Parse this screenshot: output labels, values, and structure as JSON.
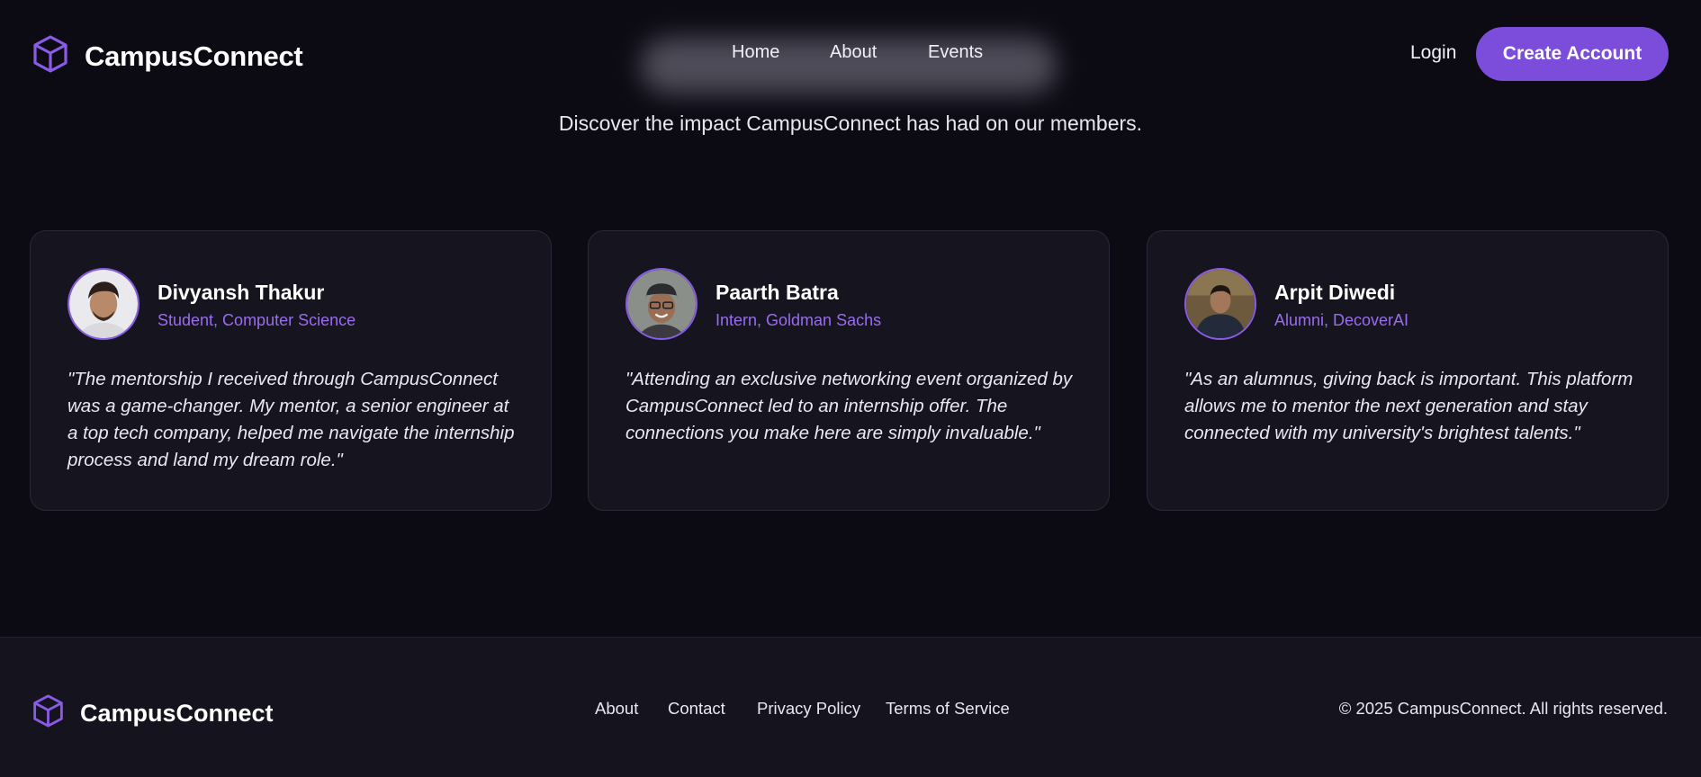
{
  "header": {
    "brand": "CampusConnect",
    "nav": [
      "Home",
      "About",
      "Events"
    ],
    "login": "Login",
    "cta": "Create Account"
  },
  "hero": {
    "subtitle": "Discover the impact CampusConnect has had on our members."
  },
  "testimonials": [
    {
      "name": "Divyansh Thakur",
      "role": "Student, Computer Science",
      "quote": "\"The mentorship I received through CampusConnect was a game-changer. My mentor, a senior engineer at a top tech company, helped me navigate the internship process and land my dream role.\""
    },
    {
      "name": "Paarth Batra",
      "role": "Intern, Goldman Sachs",
      "quote": "\"Attending an exclusive networking event organized by CampusConnect led to an internship offer. The connections you make here are simply invaluable.\""
    },
    {
      "name": "Arpit Diwedi",
      "role": "Alumni, DecoverAI",
      "quote": "\"As an alumnus, giving back is important. This platform allows me to mentor the next generation and stay connected with my university's brightest talents.\""
    }
  ],
  "footer": {
    "brand": "CampusConnect",
    "links": [
      "About",
      "Contact",
      "Privacy Policy",
      "Terms of Service"
    ],
    "copyright": "© 2025 CampusConnect. All rights reserved."
  },
  "colors": {
    "background": "#0c0b14",
    "card": "#16151f",
    "accent": "#7c4ddb",
    "role_text": "#9b6bf0"
  },
  "icons": {
    "logo": "cube-icon"
  }
}
